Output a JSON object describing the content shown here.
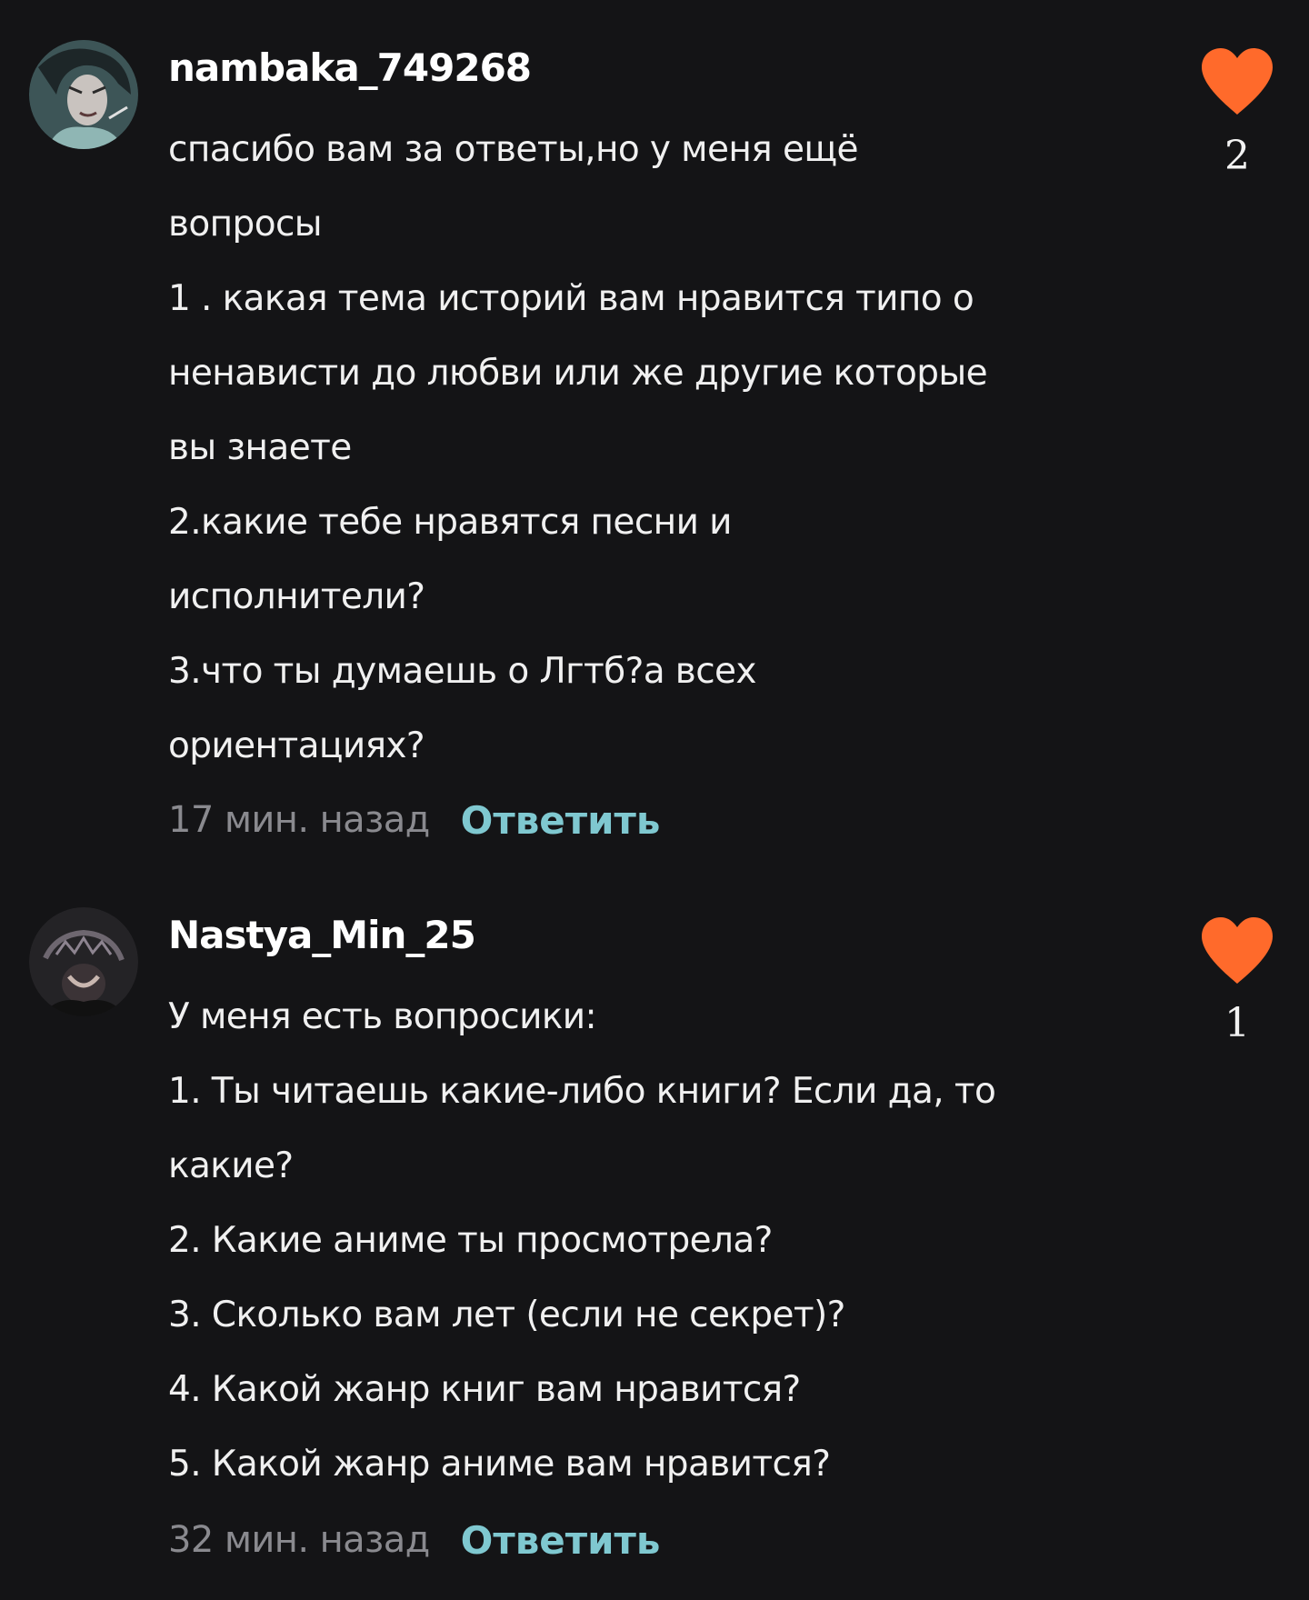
{
  "theme": {
    "background": "#141416",
    "text": "#f0f0f0",
    "muted": "#8a8a8f",
    "reply_accent": "#7fc8d0",
    "like_accent": "#ff6a2b"
  },
  "comments": [
    {
      "username": "nambaka_749268",
      "avatar_icon": "user-avatar-anime",
      "lines": [
        "спасибо вам за ответы,но у меня ещё",
        "вопросы",
        "1 . какая тема историй вам нравится типо о",
        "ненависти до любви или же другие которые",
        "вы знаете",
        "2.какие тебе нравятся песни и",
        "исполнители?",
        "3.что ты думаешь о Лгтб?а всех",
        "ориентациях?"
      ],
      "time": "17 мин. назад",
      "reply_label": "Ответить",
      "like_icon": "heart-icon",
      "likes": "2"
    },
    {
      "username": "Nastya_Min_25",
      "avatar_icon": "user-avatar-dark",
      "lines": [
        "У меня есть вопросики:",
        "1. Ты читаешь какие-либо книги? Если да, то",
        "какие?",
        "2. Какие аниме ты просмотрела?",
        "3. Сколько вам лет (если не секрет)?",
        "4. Какой жанр книг вам нравится?",
        "5. Какой жанр аниме вам нравится?"
      ],
      "time": "32 мин. назад",
      "reply_label": "Ответить",
      "like_icon": "heart-icon",
      "likes": "1"
    }
  ]
}
